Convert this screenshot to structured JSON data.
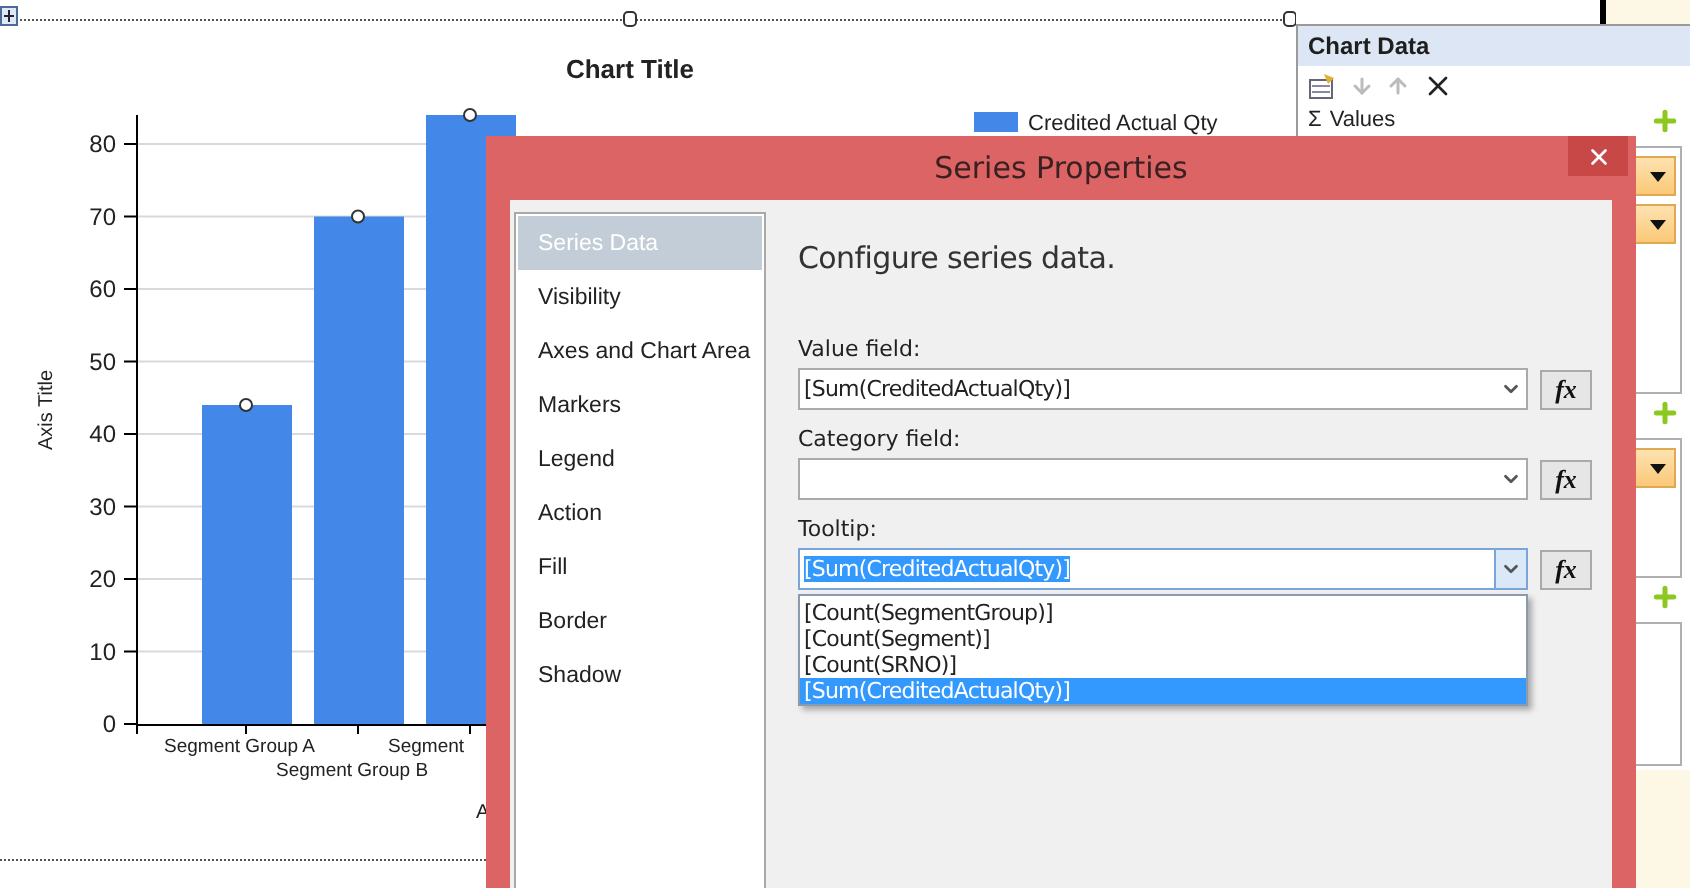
{
  "chart": {
    "chart_data": {
      "type": "bar",
      "title": "Chart Title",
      "xlabel": "A",
      "ylabel": "Axis Title",
      "categories": [
        "Segment Group A",
        "Segment Group B",
        "Segment"
      ],
      "series": [
        {
          "name": "Credited Actual Qty",
          "color": "#4388e8",
          "values": [
            44,
            70,
            84
          ]
        }
      ],
      "ylim": [
        0,
        84
      ],
      "yticks": [
        0,
        10,
        20,
        30,
        40,
        50,
        60,
        70,
        80
      ],
      "grid": true
    }
  },
  "chart_data_panel": {
    "title": "Chart Data",
    "values_symbol": "Σ",
    "values_label": "Values"
  },
  "dialog": {
    "title": "Series Properties",
    "nav": [
      {
        "label": "Series Data",
        "selected": true
      },
      {
        "label": "Visibility",
        "selected": false
      },
      {
        "label": "Axes and Chart Area",
        "selected": false
      },
      {
        "label": "Markers",
        "selected": false
      },
      {
        "label": "Legend",
        "selected": false
      },
      {
        "label": "Action",
        "selected": false
      },
      {
        "label": "Fill",
        "selected": false
      },
      {
        "label": "Border",
        "selected": false
      },
      {
        "label": "Shadow",
        "selected": false
      }
    ],
    "heading": "Configure series data.",
    "fields": [
      {
        "label": "Value field:",
        "value": "[Sum(CreditedActualQty)]",
        "button": "fx",
        "expanded": false
      },
      {
        "label": "Category field:",
        "button": "fx",
        "expanded": false
      },
      {
        "label": "Tooltip:",
        "value": "[Sum(CreditedActualQty)]",
        "button": "fx",
        "expanded": true,
        "options": [
          {
            "label": "[Count(SegmentGroup)]",
            "selected": false
          },
          {
            "label": "[Count(Segment)]",
            "selected": false
          },
          {
            "label": "[Count(SRNO)]",
            "selected": false
          },
          {
            "label": "[Sum(CreditedActualQty)]",
            "selected": true
          }
        ]
      }
    ]
  }
}
